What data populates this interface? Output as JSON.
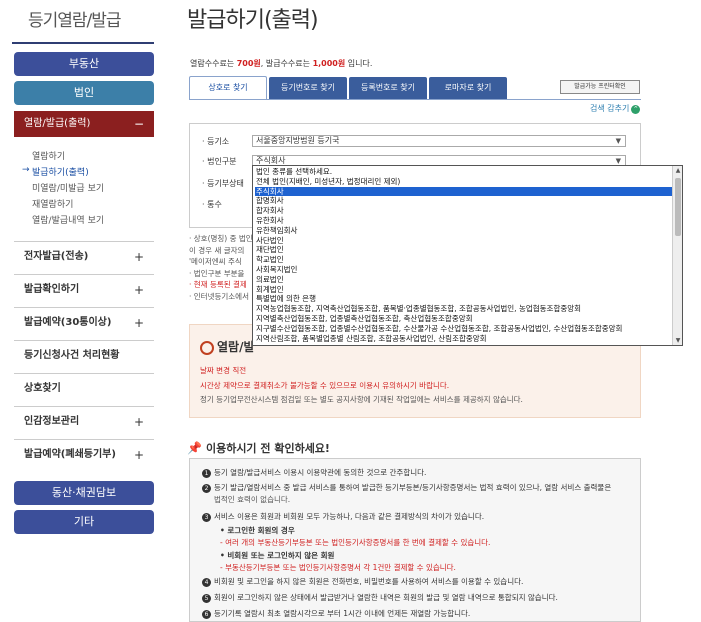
{
  "sidebar": {
    "title": "등기열람/발급",
    "buttons": [
      "부동산",
      "법인"
    ],
    "open_menu": {
      "label": "열람/발급(출력)",
      "toggle": "−"
    },
    "sub_items": [
      "열람하기",
      "발급하기(출력)",
      "미열람/미발급 보기",
      "재열람하기",
      "열람/발급내역 보기"
    ],
    "active_arrow": "→",
    "accordions": [
      {
        "label": "전자발급(전송)",
        "toggle": "+"
      },
      {
        "label": "발급확인하기",
        "toggle": "+"
      },
      {
        "label": "발급예약(30통이상)",
        "toggle": "+"
      },
      {
        "label": "등기신청사건 처리현황",
        "toggle": ""
      },
      {
        "label": "상호찾기",
        "toggle": ""
      },
      {
        "label": "인감정보관리",
        "toggle": "+"
      },
      {
        "label": "발급예약(폐쇄등기부)",
        "toggle": "+"
      }
    ],
    "bottom_buttons": [
      "동산·채권담보",
      "기타"
    ]
  },
  "main": {
    "title": "발급하기(출력)",
    "fee": {
      "prefix": "열람수수료는 ",
      "view_fee": "700원",
      "middle": ", 발급수수료는 ",
      "issue_fee": "1,000원",
      "suffix": " 입니다."
    },
    "tabs": [
      "상호로 찾기",
      "등기번호로 찾기",
      "등록번호로 찾기",
      "로마자로 찾기"
    ],
    "helper_button": "발급가능 프린터확인",
    "collapse": {
      "label": "검색 감추기",
      "icon": "up-icon",
      "glyph": "⌃"
    },
    "form": {
      "registry_label": "· 등기소",
      "registry_value": "서울중앙지방법원 등기국",
      "corp_type_label": "· 법인구분",
      "corp_type_value": "주식회사",
      "status_label": "· 등기부상태",
      "copies_label": "· 통수",
      "caret": "▼"
    },
    "notes": [
      {
        "text": "· 상호(명칭) 중 법인 직전",
        "red": false
      },
      {
        "text": "  이 경우 새 글자의",
        "red": false
      },
      {
        "text": "  '메이저엔씨 주식",
        "red": false
      },
      {
        "text": "· 법인구분 부분을",
        "red": false
      },
      {
        "text": "· 현재 등록된 결제",
        "red": true
      },
      {
        "text": "· 인터넷등기소에서",
        "red": false
      }
    ],
    "warning": {
      "title": "열람/발",
      "lines": [
        {
          "text": "날짜 변경 직전",
          "red": true
        },
        {
          "text": "시간상 제약으로 결제취소가 불가능할 수 있으므로 이용시 유의하시기 바랍니다.",
          "red": true
        },
        {
          "text": "정기 등기업무전산시스템 점검일 또는 별도 공지사항에 기재된 작업일에는 서비스를 제공하지 않습니다.",
          "red": false
        }
      ]
    },
    "check": {
      "title": "이용하시기 전 확인하세요!",
      "lines": [
        {
          "type": "num",
          "num": "1",
          "text": "등기 열람/발급서비스 이용시 이용약관에 동의한 것으로 간주합니다."
        },
        {
          "type": "num",
          "num": "2",
          "text": "등기 발급/열람서비스 중 발급 서비스를 통하여 발급한 등기부등본/등기사항증명서는 법적 효력이 있으나, 열람 서비스 출력물은"
        },
        {
          "type": "plain",
          "text": "법적인 효력이 없습니다."
        },
        {
          "type": "num",
          "num": "3",
          "text": "서비스 이용은 회원과 비회원 모두 가능하나, 다음과 같은 결제방식의 차이가 있습니다."
        },
        {
          "type": "sub-b",
          "text": "• 로그인한 회원의 경우"
        },
        {
          "type": "sub-r",
          "text": "- 여러 개의 부동산등기부등본 또는 법인등기사항증명서를 한 번에 결제할 수 있습니다."
        },
        {
          "type": "sub-b",
          "text": "• 비회원 또는 로그인하지 않은 회원"
        },
        {
          "type": "sub-r",
          "text": "- 부동산등기부등본 또는 법인등기사항증명서 각 1건만 결제할 수 있습니다."
        },
        {
          "type": "num",
          "num": "4",
          "text": "비회원 및 로그인을 하지 않은 회원은 전화번호, 비밀번호를 사용하여 서비스를 이용할 수 있습니다."
        },
        {
          "type": "num",
          "num": "5",
          "text": "회원이 로그인하지 않은 상태에서 발급받거나 열람한 내역은 회원의 발급 및 열람 내역으로 통합되지 않습니다."
        },
        {
          "type": "num",
          "num": "6",
          "text": "등기기록 열람시 최초 열람시각으로 부터 1시간 이내에 언제든 재열람 가능합니다."
        }
      ]
    }
  },
  "dropdown": {
    "options": [
      "법인 종류를 선택하세요.",
      "전체 법인(지배인, 미성년자, 법정대리인 제외)",
      "주식회사",
      "합명회사",
      "합자회사",
      "유한회사",
      "유한책임회사",
      "사단법인",
      "재단법인",
      "학교법인",
      "사회복지법인",
      "의료법인",
      "회계법인",
      "특별법에 의한 은행",
      "지역농업협동조합, 지역축산업협동조합, 품목별·업종별협동조합, 조합공동사업법인, 농업협동조합중앙회",
      "지역별축산업협동조합, 업종별축산업협동조합, 축산업협동조합중앙회",
      "지구별수산업협동조합, 업종별수산업협동조합, 수산물가공 수산업협동조합, 조합공동사업법인, 수산업협동조합중앙회",
      "지역산림조합, 품목별업종별 산림조합, 조합공동사업법인, 산림조합중앙회",
      "중소기업협동조합, 사업협동조합, 협동조합연합회, 중소기업중앙회",
      "신용협동조합, 신용협동조합중앙회"
    ],
    "selected_index": 2,
    "scroll_up": "▲",
    "scroll_down": "▼"
  }
}
